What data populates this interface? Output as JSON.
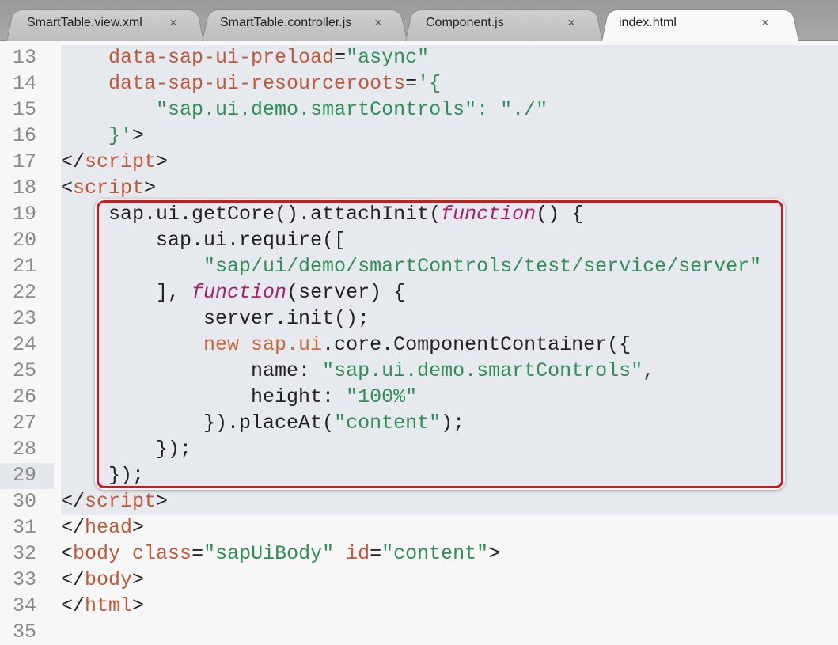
{
  "tabs": [
    {
      "label": "SmartTable.view.xml",
      "close": "×",
      "active": false
    },
    {
      "label": "SmartTable.controller.js",
      "close": "×",
      "active": false
    },
    {
      "label": "Component.js",
      "close": "×",
      "active": false
    },
    {
      "label": "index.html",
      "close": "×",
      "active": true
    }
  ],
  "highlight_color": "#d8141c",
  "lines": [
    {
      "n": "13",
      "tokens": [
        [
          "    ",
          "p"
        ],
        [
          "data-sap-ui-preload",
          "t"
        ],
        [
          "=",
          "p"
        ],
        [
          "\"async\"",
          "s"
        ]
      ]
    },
    {
      "n": "14",
      "tokens": [
        [
          "    ",
          "p"
        ],
        [
          "data-sap-ui-resourceroots",
          "t"
        ],
        [
          "=",
          "p"
        ],
        [
          "'{",
          "s"
        ]
      ]
    },
    {
      "n": "15",
      "tokens": [
        [
          "        ",
          "p"
        ],
        [
          "\"sap.ui.demo.smartControls\": \"./\"",
          "s"
        ]
      ]
    },
    {
      "n": "16",
      "tokens": [
        [
          "    ",
          "p"
        ],
        [
          "}'",
          "s"
        ],
        [
          ">",
          "p"
        ]
      ]
    },
    {
      "n": "17",
      "tokens": [
        [
          "</",
          "p"
        ],
        [
          "script",
          "t"
        ],
        [
          ">",
          "p"
        ]
      ]
    },
    {
      "n": "18",
      "tokens": [
        [
          "<",
          "p"
        ],
        [
          "script",
          "t"
        ],
        [
          ">",
          "p"
        ]
      ]
    },
    {
      "n": "19",
      "tokens": [
        [
          "    sap.ui.getCore().attachInit(",
          "p"
        ],
        [
          "function",
          "k"
        ],
        [
          "() {",
          "p"
        ]
      ]
    },
    {
      "n": "20",
      "tokens": [
        [
          "        sap.ui.require([",
          "p"
        ]
      ]
    },
    {
      "n": "21",
      "tokens": [
        [
          "            ",
          "p"
        ],
        [
          "\"sap/ui/demo/smartControls/test/service/server\"",
          "s"
        ]
      ]
    },
    {
      "n": "22",
      "tokens": [
        [
          "        ], ",
          "p"
        ],
        [
          "function",
          "k"
        ],
        [
          "(server) {",
          "p"
        ]
      ]
    },
    {
      "n": "23",
      "tokens": [
        [
          "            server.init();",
          "p"
        ]
      ]
    },
    {
      "n": "24",
      "tokens": [
        [
          "            ",
          "p"
        ],
        [
          "new ",
          "n"
        ],
        [
          "sap.ui",
          "n"
        ],
        [
          ".core.ComponentContainer({",
          "p"
        ]
      ]
    },
    {
      "n": "25",
      "tokens": [
        [
          "                name: ",
          "p"
        ],
        [
          "\"sap.ui.demo.smartControls\"",
          "s"
        ],
        [
          ",",
          "p"
        ]
      ]
    },
    {
      "n": "26",
      "tokens": [
        [
          "                height: ",
          "p"
        ],
        [
          "\"100%\"",
          "s"
        ]
      ]
    },
    {
      "n": "27",
      "tokens": [
        [
          "            }).placeAt(",
          "p"
        ],
        [
          "\"content\"",
          "s"
        ],
        [
          ");",
          "p"
        ]
      ]
    },
    {
      "n": "28",
      "tokens": [
        [
          "        });",
          "p"
        ]
      ]
    },
    {
      "n": "29",
      "tokens": [
        [
          "    });",
          "p"
        ]
      ]
    },
    {
      "n": "30",
      "tokens": [
        [
          "</",
          "p"
        ],
        [
          "script",
          "t"
        ],
        [
          ">",
          "p"
        ]
      ]
    },
    {
      "n": "31",
      "tokens": [
        [
          "</",
          "p"
        ],
        [
          "head",
          "t"
        ],
        [
          ">",
          "p"
        ]
      ]
    },
    {
      "n": "32",
      "tokens": [
        [
          "<",
          "p"
        ],
        [
          "body",
          "t"
        ],
        [
          " ",
          "p"
        ],
        [
          "class",
          "t"
        ],
        [
          "=",
          "p"
        ],
        [
          "\"sapUiBody\"",
          "s"
        ],
        [
          " ",
          "p"
        ],
        [
          "id",
          "t"
        ],
        [
          "=",
          "p"
        ],
        [
          "\"content\"",
          "s"
        ],
        [
          ">",
          "p"
        ]
      ]
    },
    {
      "n": "33",
      "tokens": [
        [
          "</",
          "p"
        ],
        [
          "body",
          "t"
        ],
        [
          ">",
          "p"
        ]
      ]
    },
    {
      "n": "34",
      "tokens": [
        [
          "</",
          "p"
        ],
        [
          "html",
          "t"
        ],
        [
          ">",
          "p"
        ]
      ]
    },
    {
      "n": "35",
      "tokens": []
    }
  ]
}
